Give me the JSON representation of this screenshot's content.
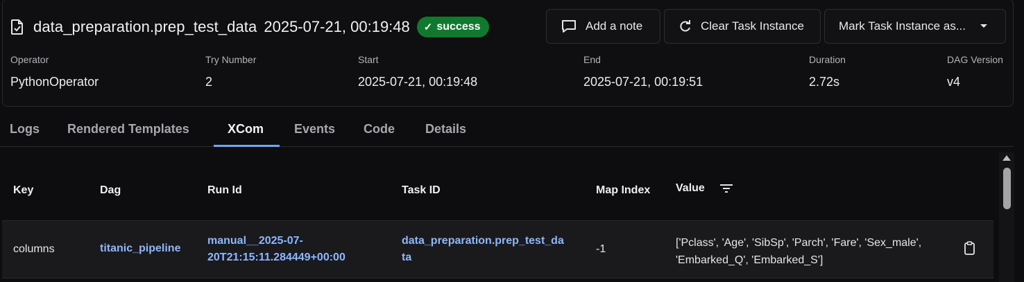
{
  "header": {
    "task_title": "data_preparation.prep_test_data",
    "task_date": "2025-07-21, 00:19:48",
    "status_badge": "success",
    "status_color": "#0f7a2e",
    "buttons": {
      "add_note": "Add a note",
      "clear_instance": "Clear Task Instance",
      "mark_instance": "Mark Task Instance as..."
    }
  },
  "meta": [
    {
      "label": "Operator",
      "value": "PythonOperator"
    },
    {
      "label": "Try Number",
      "value": "2"
    },
    {
      "label": "Start",
      "value": "2025-07-21, 00:19:48"
    },
    {
      "label": "End",
      "value": "2025-07-21, 00:19:51"
    },
    {
      "label": "Duration",
      "value": "2.72s"
    },
    {
      "label": "DAG Version",
      "value": "v4"
    }
  ],
  "tabs": [
    {
      "label": "Logs"
    },
    {
      "label": "Rendered Templates"
    },
    {
      "label": "XCom",
      "active": true
    },
    {
      "label": "Events"
    },
    {
      "label": "Code"
    },
    {
      "label": "Details"
    }
  ],
  "accent_color": "#6fa8ff",
  "table": {
    "headers": {
      "key": "Key",
      "dag": "Dag",
      "run_id": "Run Id",
      "task_id": "Task ID",
      "map_index": "Map Index",
      "value": "Value"
    },
    "rows": [
      {
        "key": "columns",
        "dag": "titanic_pipeline",
        "run_id_line1": "manual__2025-07-",
        "run_id_line2": "20T21:15:11.284449+00:00",
        "task_id_line1": "data_preparation.prep_test_da",
        "task_id_line2": "ta",
        "map_index": "-1",
        "value_line1": "['Pclass', 'Age', 'SibSp', 'Parch', 'Fare', 'Sex_male',",
        "value_line2": "'Embarked_Q', 'Embarked_S']"
      }
    ]
  }
}
